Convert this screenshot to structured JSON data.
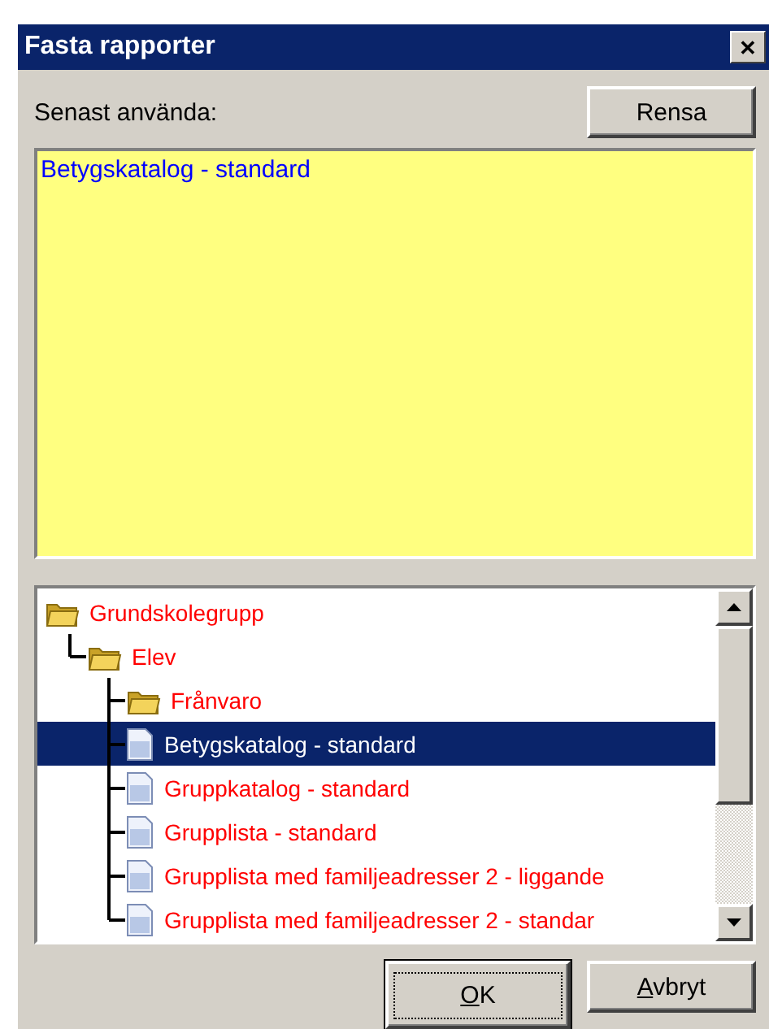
{
  "window": {
    "title": "Fasta rapporter",
    "close": "✕"
  },
  "recent": {
    "label": "Senast använda:",
    "clear_button": "Rensa",
    "items": [
      {
        "label": "Betygskatalog - standard"
      }
    ]
  },
  "tree": [
    {
      "label": "Grundskolegrupp",
      "kind": "folder",
      "selected": false,
      "children": [
        {
          "label": "Elev",
          "kind": "folder",
          "selected": false,
          "children": [
            {
              "label": "Frånvaro",
              "kind": "folder",
              "selected": false
            },
            {
              "label": "Betygskatalog - standard",
              "kind": "report",
              "selected": true
            },
            {
              "label": "Gruppkatalog - standard",
              "kind": "report",
              "selected": false
            },
            {
              "label": "Grupplista - standard",
              "kind": "report",
              "selected": false
            },
            {
              "label": "Grupplista med familjeadresser 2 - liggande",
              "kind": "report",
              "selected": false
            },
            {
              "label": "Grupplista med familjeadresser 2 - standar",
              "kind": "report",
              "selected": false
            }
          ]
        }
      ]
    }
  ],
  "buttons": [
    {
      "label": "OK",
      "default": true,
      "underline_first": true
    },
    {
      "label": "Avbryt",
      "default": false,
      "underline_first": true
    }
  ]
}
